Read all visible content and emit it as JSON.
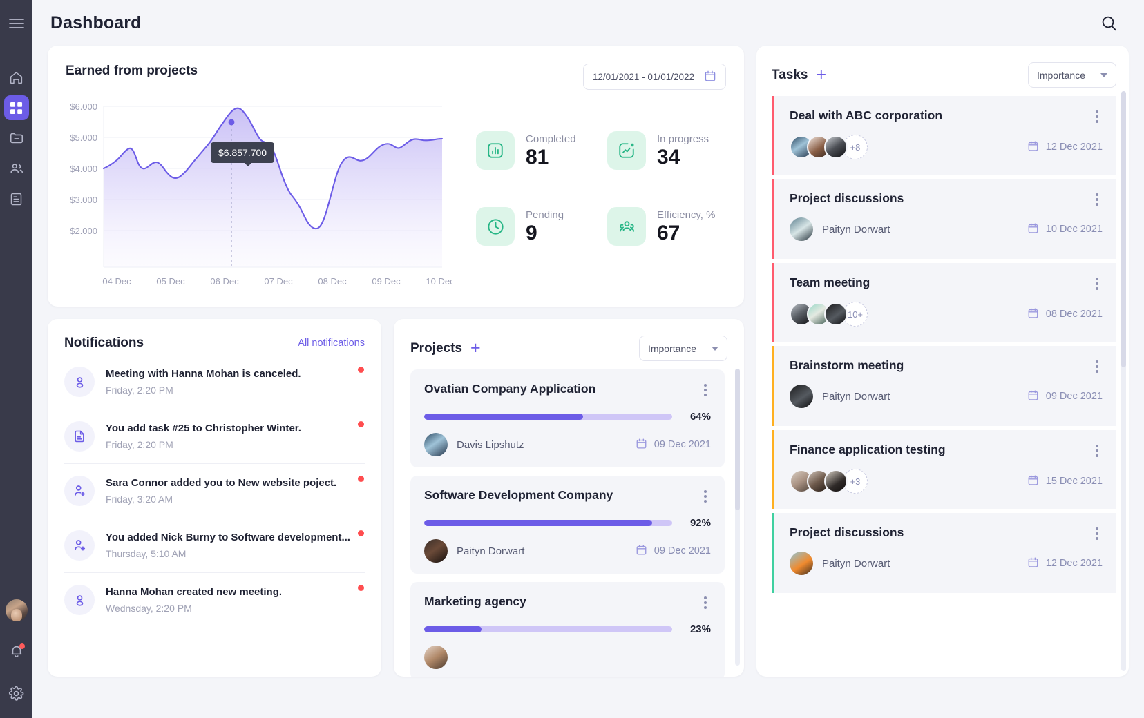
{
  "sidebar": {
    "menu_icon": "hamburger-icon",
    "items": [
      {
        "icon": "home-icon",
        "name": "home",
        "active": false
      },
      {
        "icon": "grid-icon",
        "name": "dashboard",
        "active": true
      },
      {
        "icon": "folder-minus-icon",
        "name": "projects",
        "active": false
      },
      {
        "icon": "users-icon",
        "name": "team",
        "active": false
      },
      {
        "icon": "document-icon",
        "name": "reports",
        "active": false
      }
    ],
    "bottom": {
      "avatar": "user-avatar",
      "bell_icon": "bell-icon",
      "bell_has_badge": true,
      "settings_icon": "gear-icon"
    }
  },
  "header": {
    "title": "Dashboard",
    "search_icon": "search-icon"
  },
  "earned": {
    "title": "Earned from projects",
    "date_range": "12/01/2021 - 01/01/2022",
    "calendar_icon": "calendar-icon",
    "tooltip": "$6.857.700",
    "stats": [
      {
        "label": "Completed",
        "value": "81",
        "icon": "bar-chart-icon"
      },
      {
        "label": "In progress",
        "value": "34",
        "icon": "trend-line-icon"
      },
      {
        "label": "Pending",
        "value": "9",
        "icon": "clock-icon"
      },
      {
        "label": "Efficiency, %",
        "value": "67",
        "icon": "people-group-icon"
      }
    ]
  },
  "chart_data": {
    "type": "area",
    "title": "Earned from projects",
    "xlabel": "",
    "ylabel": "",
    "ylim": [
      1500,
      6200
    ],
    "yticks": [
      "$2.000",
      "$3.000",
      "$4.000",
      "$5.000",
      "$6.000"
    ],
    "ytick_values": [
      2000,
      3000,
      4000,
      5000,
      6000
    ],
    "categories": [
      "04 Dec",
      "05 Dec",
      "06 Dec",
      "07 Dec",
      "08 Dec",
      "09 Dec",
      "10 Dec"
    ],
    "grid": true,
    "legend": "none",
    "line_color": "#6c5ce7",
    "fill_color": "#d7d1f7",
    "highlight": {
      "x_label": "07 Dec",
      "value": 6857700,
      "display": "$6.857.700"
    },
    "x": [
      0,
      0.1,
      0.2,
      0.3,
      0.38,
      0.46,
      0.55,
      0.64,
      0.72,
      0.8,
      0.9,
      1.0,
      1.1,
      1.2,
      1.3,
      1.4,
      1.5,
      1.6,
      1.7,
      1.8,
      1.9,
      2.0,
      2.1,
      2.25,
      2.4,
      2.55,
      2.7,
      2.8,
      2.9,
      3.0,
      3.1,
      3.2,
      3.3,
      3.4,
      3.5,
      3.6,
      3.7,
      3.8,
      3.9,
      4.0,
      4.1,
      4.2,
      4.3,
      4.4,
      4.5,
      4.6,
      4.7,
      4.8,
      4.9,
      5.0,
      5.1,
      5.2,
      5.3,
      5.4,
      5.5,
      5.6,
      5.7,
      5.8,
      5.9,
      6.0
    ],
    "values": [
      4180,
      4230,
      4300,
      4420,
      4700,
      4740,
      4560,
      4180,
      4160,
      4300,
      4400,
      4390,
      4270,
      4100,
      3990,
      3990,
      4060,
      4180,
      4320,
      4470,
      4620,
      4760,
      4950,
      5250,
      5620,
      5870,
      5960,
      5900,
      5700,
      5350,
      5150,
      5190,
      5060,
      4700,
      4300,
      4020,
      3900,
      3760,
      3450,
      3240,
      3220,
      3300,
      3900,
      4500,
      4720,
      4760,
      4660,
      4640,
      4700,
      4820,
      4950,
      5040,
      5080,
      5020,
      5060,
      5150,
      5190,
      5170,
      5160,
      5180
    ]
  },
  "notifications": {
    "title": "Notifications",
    "all_label": "All notifications",
    "items": [
      {
        "text": "Meeting with Hanna Mohan is canceled.",
        "time": "Friday, 2:20 PM",
        "icon": "user-icon",
        "unread": true
      },
      {
        "text": "You add task #25 to Christopher Winter.",
        "time": "Friday, 2:20 PM",
        "icon": "document-icon",
        "unread": true
      },
      {
        "text": "Sara Connor added you to New website poject.",
        "time": "Friday, 3:20 AM",
        "icon": "user-add-icon",
        "unread": true
      },
      {
        "text": "You added Nick Burny to Software development...",
        "time": "Thursday, 5:10 AM",
        "icon": "user-add-icon",
        "unread": true
      },
      {
        "text": "Hanna Mohan created new meeting.",
        "time": "Wednsday, 2:20 PM",
        "icon": "user-icon",
        "unread": true
      }
    ]
  },
  "projects": {
    "title": "Projects",
    "add_icon": "plus-icon",
    "sort_label": "Importance",
    "items": [
      {
        "name": "Ovatian Company Application",
        "progress": "64%",
        "progress_value": 64,
        "person": "Davis Lipshutz",
        "date": "09 Dec 2021",
        "avatar_class": "a1"
      },
      {
        "name": "Software Development Company",
        "progress": "92%",
        "progress_value": 92,
        "person": "Paityn Dorwart",
        "date": "09 Dec 2021",
        "avatar_class": "a5"
      },
      {
        "name": "Marketing agency",
        "progress": "23%",
        "progress_value": 23,
        "person": "",
        "date": "",
        "avatar_class": "a4"
      }
    ]
  },
  "tasks": {
    "title": "Tasks",
    "add_icon": "plus-icon",
    "sort_label": "Importance",
    "items": [
      {
        "name": "Deal with ABC corporation",
        "date": "12 Dec 2021",
        "accent": "#ff5b6e",
        "overflow": "+8",
        "avatars": [
          "a1",
          "a2",
          "a3"
        ],
        "person": ""
      },
      {
        "name": "Project discussions",
        "date": "10 Dec 2021",
        "accent": "#ff5b6e",
        "overflow": "",
        "avatars": [
          "a6"
        ],
        "person": "Paityn Dorwart"
      },
      {
        "name": "Team meeting",
        "date": "08 Dec 2021",
        "accent": "#ff5b6e",
        "overflow": "10+",
        "avatars": [
          "a8",
          "a7",
          "a9"
        ],
        "person": ""
      },
      {
        "name": "Brainstorm meeting",
        "date": "09 Dec 2021",
        "accent": "#ffb020",
        "overflow": "",
        "avatars": [
          "a9"
        ],
        "person": "Paityn Dorwart"
      },
      {
        "name": "Finance application testing",
        "date": "15 Dec 2021",
        "accent": "#ffb020",
        "overflow": "+3",
        "avatars": [
          "a10",
          "a11",
          "a12"
        ],
        "person": ""
      },
      {
        "name": "Project discussions",
        "date": "12 Dec 2021",
        "accent": "#3fd0a0",
        "overflow": "",
        "avatars": [
          "a13"
        ],
        "person": "Paityn Dorwart"
      }
    ]
  },
  "colors": {
    "accent": "#6c5ce7",
    "sidebar_bg": "#393a4a",
    "page_bg": "#f4f5f9",
    "danger": "#ff5b6e",
    "warning": "#ffb020",
    "success": "#3fd0a0"
  }
}
